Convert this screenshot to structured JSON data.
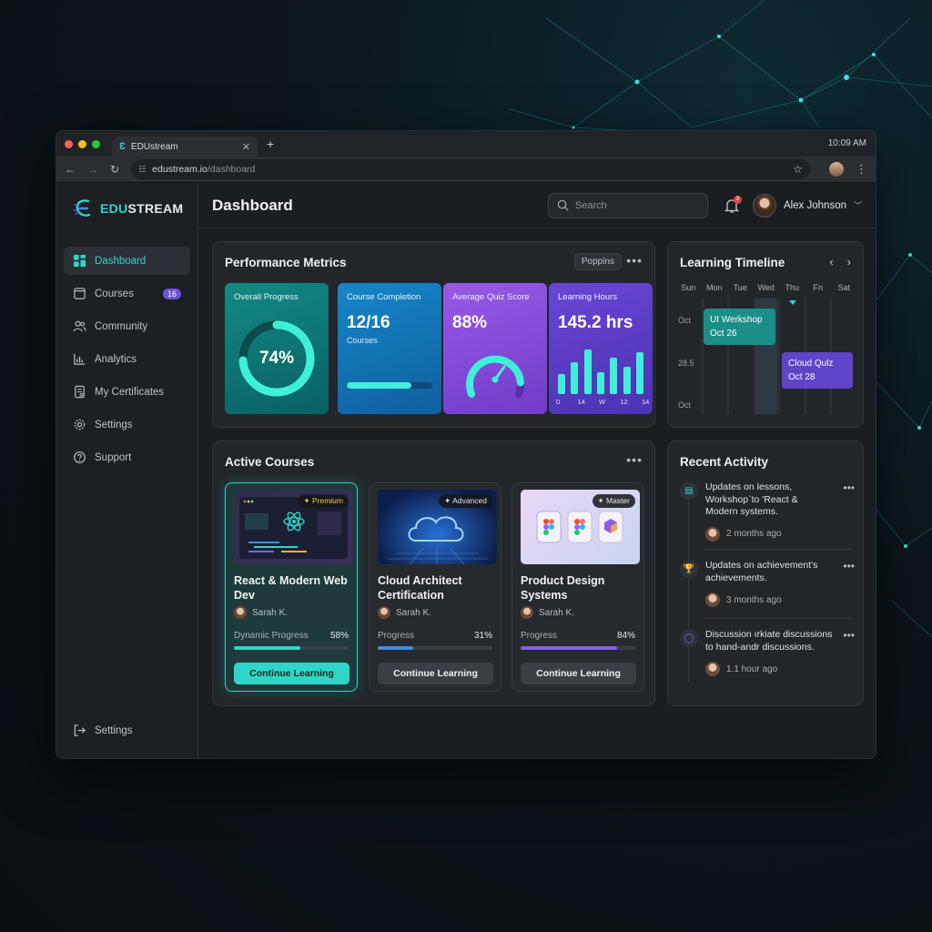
{
  "browser": {
    "tab_title": "EDUstream",
    "url_host": "edustream.io",
    "url_path": "/dashboard",
    "clock": "10:09 AM"
  },
  "brand": {
    "name_part1": "EDU",
    "name_part2": "STREAM",
    "accent": "#2fd6c8"
  },
  "sidebar": {
    "items": [
      {
        "label": "Dashboard",
        "icon": "grid-icon",
        "active": true
      },
      {
        "label": "Courses",
        "icon": "book-icon",
        "badge": "16"
      },
      {
        "label": "Community",
        "icon": "users-icon"
      },
      {
        "label": "Analytics",
        "icon": "chart-icon"
      },
      {
        "label": "My Certificates",
        "icon": "certificate-icon"
      },
      {
        "label": "Settings",
        "icon": "gear-icon"
      },
      {
        "label": "Support",
        "icon": "help-icon"
      }
    ],
    "bottom_label": "Settings"
  },
  "header": {
    "title": "Dashboard",
    "search_placeholder": "Search",
    "notification_count": "3",
    "user_name": "Alex Johnson"
  },
  "metrics": {
    "title": "Performance Metrics",
    "font_chip": "Poppins",
    "cards": [
      {
        "label": "Overall Progress",
        "value": "74%",
        "progress": 0.74,
        "color": "#0f7f7f"
      },
      {
        "label": "Course Completion",
        "value": "12/16",
        "sub": "Courses",
        "progress": 0.75,
        "color": "#1478b8"
      },
      {
        "label": "Average Quiz Score",
        "value": "88%",
        "progress": 0.88,
        "color": "#8b4fd8"
      },
      {
        "label": "Learning Hours",
        "value": "145.2 hrs",
        "bars": [
          0.4,
          0.65,
          0.9,
          0.45,
          0.75,
          0.55,
          0.85
        ],
        "bar_labels": [
          "0",
          "14",
          "W",
          "12",
          "14"
        ],
        "color": "#5b3fc4"
      }
    ]
  },
  "timeline": {
    "title": "Learning Timeline",
    "days": [
      "Sun",
      "Mon",
      "Tue",
      "Wed",
      "Thu",
      "Fri",
      "Sat"
    ],
    "row_labels": [
      "Oct",
      "28.5",
      "Oct"
    ],
    "events": [
      {
        "title": "UI Werkshop",
        "date": "Oct 26",
        "color": "#1a8f87"
      },
      {
        "title": "Cloud Qulz",
        "date": "Oct 28",
        "color": "#5f44c9"
      }
    ]
  },
  "courses": {
    "title": "Active Courses",
    "items": [
      {
        "title": "React & Modern Web Dev",
        "badge": "✦ Premium",
        "author": "Sarah K.",
        "progress_label": "Dynamic Progress",
        "progress": "58%",
        "progress_value": 0.58,
        "color": "#2fd6c8",
        "button": "Continue Learning"
      },
      {
        "title": "Cloud Architect Certification",
        "badge": "✦ Advanced",
        "author": "Sarah K.",
        "progress_label": "Progress",
        "progress": "31%",
        "progress_value": 0.31,
        "color": "#3b8fe0",
        "button": "Continue Learning"
      },
      {
        "title": "Product Design Systems",
        "badge": "✦ Master",
        "author": "Sarah K.",
        "progress_label": "Progress",
        "progress": "84%",
        "progress_value": 0.84,
        "color": "#8a5ce6",
        "button": "Continue Learning"
      }
    ]
  },
  "activity": {
    "title": "Recent Activity",
    "items": [
      {
        "text": "Updates on lessons, Workshop`to 'React & Modern systems.",
        "time": "2 months ago",
        "icon": "document-icon",
        "color": "#2fd6c8"
      },
      {
        "text": "Updates on achievement's achievements.",
        "time": "3 months ago",
        "icon": "trophy-icon",
        "color": "#e8b430"
      },
      {
        "text": "Discussion ırkiate discussions to hand-andr discussions.",
        "time": "1.1 hour ago",
        "icon": "chat-icon",
        "color": "#7a6cf0"
      }
    ]
  }
}
